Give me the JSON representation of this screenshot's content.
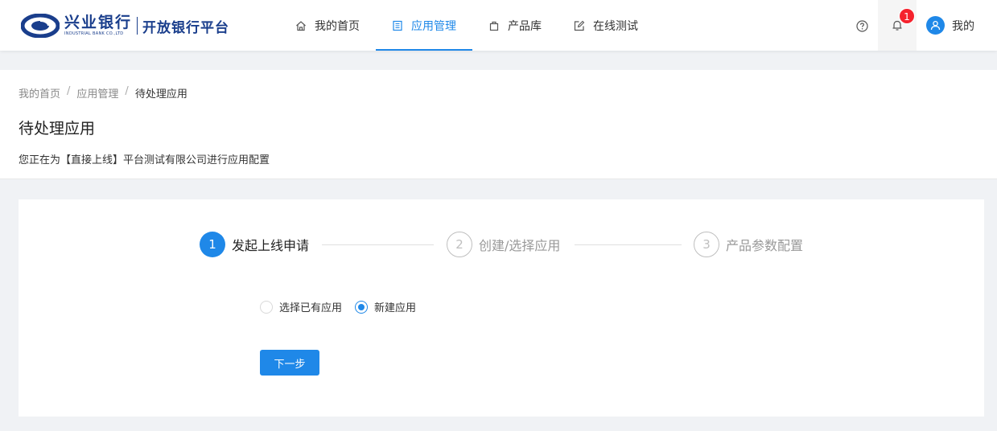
{
  "brand": {
    "bank_name": "兴业银行",
    "bank_name_en": "INDUSTRIAL BANK CO.,LTD",
    "platform_name": "开放银行平台",
    "brand_color": "#1a3e8c"
  },
  "nav": {
    "items": [
      {
        "label": "我的首页",
        "icon": "home-icon",
        "active": false
      },
      {
        "label": "应用管理",
        "icon": "app-list-icon",
        "active": true
      },
      {
        "label": "产品库",
        "icon": "bag-icon",
        "active": false
      },
      {
        "label": "在线测试",
        "icon": "edit-icon",
        "active": false
      }
    ],
    "accent_color": "#1f88e8"
  },
  "header_right": {
    "help_icon": "question-circle-icon",
    "bell_icon": "bell-icon",
    "notification_count": "1",
    "user_label": "我的",
    "user_icon": "user-icon"
  },
  "breadcrumb": {
    "items": [
      "我的首页",
      "应用管理",
      "待处理应用"
    ],
    "separator": "/"
  },
  "page": {
    "title": "待处理应用",
    "description": "您正在为【直接上线】平台测试有限公司进行应用配置"
  },
  "steps": [
    {
      "number": "1",
      "label": "发起上线申请",
      "status": "active"
    },
    {
      "number": "2",
      "label": "创建/选择应用",
      "status": "wait"
    },
    {
      "number": "3",
      "label": "产品参数配置",
      "status": "wait"
    }
  ],
  "form": {
    "options": [
      {
        "label": "选择已有应用",
        "checked": false
      },
      {
        "label": "新建应用",
        "checked": true
      }
    ],
    "next_label": "下一步"
  }
}
